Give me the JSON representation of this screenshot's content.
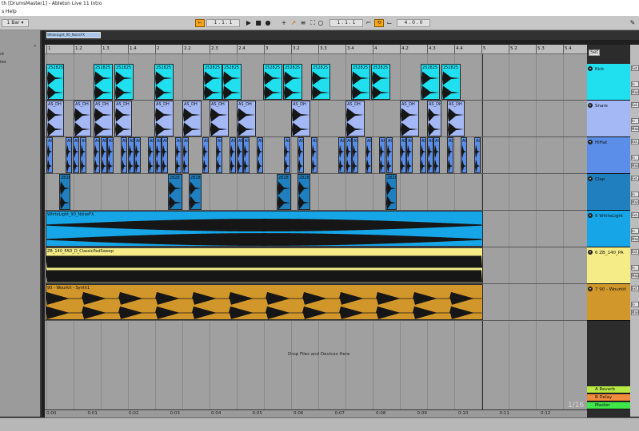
{
  "window": {
    "title": "th  [DrumsMaster1] - Ableton Live 11 Intro"
  },
  "menu": {
    "items": "s   Help"
  },
  "toolbar": {
    "quantization": "1 Bar",
    "arrangement_position": "1 .  1 .  1",
    "loop_start": "1 .  1 .  1",
    "loop_length": "4 .  0 .  0"
  },
  "browser": {
    "items": [
      "ct",
      "ies"
    ]
  },
  "overview": {
    "clip_label": "WhiteLight_90_NoiseFX"
  },
  "ruler": {
    "bar_labels": [
      "1",
      "1.2",
      "1.3",
      "1.4",
      "2",
      "2.2",
      "2.3",
      "2.4",
      "3",
      "3.2",
      "3.3",
      "3.4",
      "4",
      "4.2",
      "4.3",
      "4.4",
      "5",
      "5.2",
      "5.3",
      "5.4"
    ]
  },
  "time_ruler": {
    "labels": [
      "0:00",
      "0:01",
      "0:02",
      "0:03",
      "0:04",
      "0:05",
      "0:06",
      "0:07",
      "0:08",
      "0:09",
      "0:10",
      "0:11",
      "0:12"
    ]
  },
  "tracks": [
    {
      "id": "kick",
      "name": "Kick",
      "color": "#20e0f0",
      "clip_prefix": "252825"
    },
    {
      "id": "snare",
      "name": "Snare",
      "color": "#a3b8f5",
      "clip_prefix": "AS_DH"
    },
    {
      "id": "hihat",
      "name": "HiHat",
      "color": "#5a8ee8",
      "clip_prefix": "AI"
    },
    {
      "id": "clap",
      "name": "Clap",
      "color": "#1f7fbf",
      "clip_prefix": "2828"
    },
    {
      "id": "white",
      "name": "5 WhiteLight",
      "color": "#16a6e8",
      "clip_prefix": "WhiteLight_90_NoiseFX"
    },
    {
      "id": "pad",
      "name": "6 ZB_140_PA",
      "color": "#f5ec88",
      "clip_prefix": "ZB_140_PAD_D_ClassicPadSweep"
    },
    {
      "id": "synth",
      "name": "7 90 - Wourkit",
      "color": "#d2972a",
      "clip_prefix": "90 - Wourkit - Synth1"
    }
  ],
  "returns": [
    {
      "id": "reverb",
      "name": "A Reverb",
      "color": "#b8e842"
    },
    {
      "id": "delay",
      "name": "B Delay",
      "color": "#f08c3c"
    },
    {
      "id": "master",
      "name": "Master",
      "color": "#3ee64a"
    }
  ],
  "arrangement": {
    "drop_text": "Drop Files and Devices Here",
    "quantization_display": "1/16"
  },
  "io": {
    "ext": "Ext.",
    "in": "In",
    "master": "Mast"
  },
  "set_button": "Set"
}
